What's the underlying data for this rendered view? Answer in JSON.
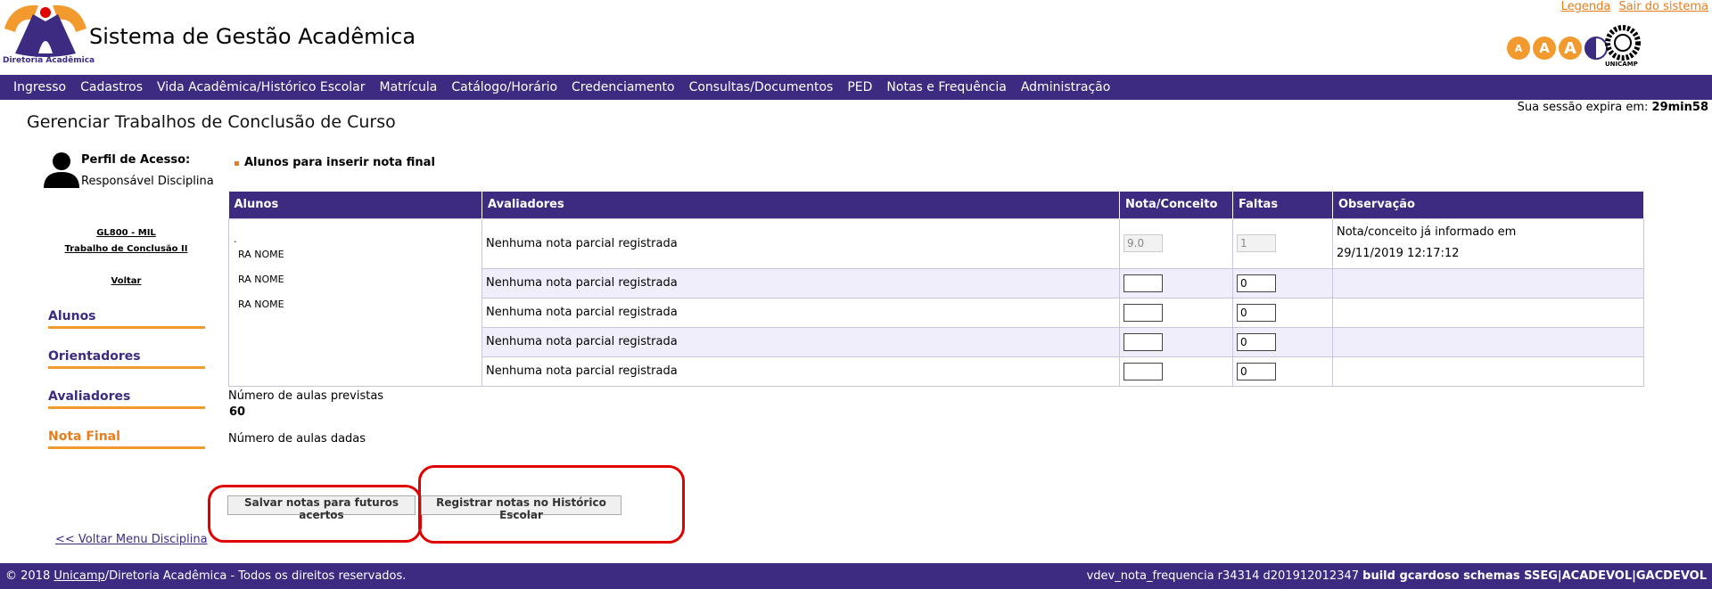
{
  "header": {
    "logo_caption": "Diretoria Acadêmica",
    "title": "Sistema de Gestão Acadêmica",
    "links": [
      "Legenda",
      "Sair do sistema"
    ],
    "font_buttons": [
      "A",
      "A",
      "A"
    ],
    "unicamp_caption": "UNICAMP"
  },
  "nav": [
    "Ingresso",
    "Cadastros",
    "Vida Acadêmica/Histórico Escolar",
    "Matrícula",
    "Catálogo/Horário",
    "Credenciamento",
    "Consultas/Documentos",
    "PED",
    "Notas e Frequência",
    "Administração"
  ],
  "page": {
    "title": "Gerenciar Trabalhos de Conclusão de Curso",
    "session_label": "Sua sessão expira em:",
    "session_time": "29min58"
  },
  "sidebar": {
    "profile_label": "Perfil de Acesso:",
    "profile_value": "Responsável Disciplina",
    "course_code": "GL800 - MIL",
    "course_name": "Trabalho de Conclusão II",
    "back": "Voltar",
    "menu": [
      "Alunos",
      "Orientadores",
      "Avaliadores",
      "Nota Final"
    ],
    "back_menu": "<< Voltar Menu Disciplina"
  },
  "main": {
    "section_title": "Alunos para inserir nota final",
    "columns": [
      "Alunos",
      "Avaliadores",
      "Nota/Conceito",
      "Faltas",
      "Observação"
    ],
    "students_dot": ".",
    "students": [
      "RA  NOME",
      "RA NOME",
      "RA NOME"
    ],
    "rows": [
      {
        "avaliadores": "Nenhuma nota parcial registrada",
        "nota": "9.0",
        "faltas": "1",
        "obs_1": "Nota/conceito já informado em",
        "obs_2": "29/11/2019 12:17:12"
      },
      {
        "avaliadores": "Nenhuma nota parcial registrada",
        "nota": "",
        "faltas": "0",
        "obs_1": "",
        "obs_2": ""
      },
      {
        "avaliadores": "Nenhuma nota parcial registrada",
        "nota": "",
        "faltas": "0",
        "obs_1": "",
        "obs_2": ""
      },
      {
        "avaliadores": "Nenhuma nota parcial registrada",
        "nota": "",
        "faltas": "0",
        "obs_1": "",
        "obs_2": ""
      },
      {
        "avaliadores": "Nenhuma nota parcial registrada",
        "nota": "",
        "faltas": "0",
        "obs_1": "",
        "obs_2": ""
      }
    ],
    "aulas_previstas_label": "Número de aulas previstas",
    "aulas_previstas_value": "60",
    "aulas_dadas_label": "Número de aulas dadas",
    "btn_save": "Salvar notas para futuros acertos",
    "btn_register": "Registrar notas no Histórico Escolar"
  },
  "footer": {
    "copy_prefix": "© 2018 ",
    "copy_link": "Unicamp",
    "copy_suffix": "/Diretoria Acadêmica - Todos os direitos reservados.",
    "build_info": "vdev_nota_frequencia r34314 d201912012347 ",
    "build_bold": "build gcardoso schemas SSEG|ACADEVOL|GACDEVOL"
  },
  "colors": {
    "brand": "#3d2b82",
    "accent": "#e87d1e",
    "highlight": "#e00000"
  }
}
